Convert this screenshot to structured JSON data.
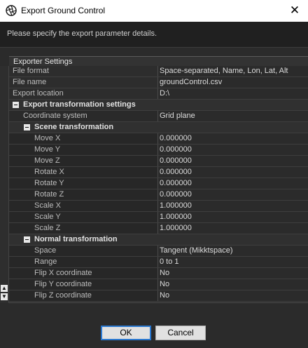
{
  "window": {
    "title": "Export Ground Control",
    "app_icon": "camera-aperture-icon",
    "close_glyph": "✕"
  },
  "instruction": "Please specify the export parameter details.",
  "group": {
    "title": "Exporter Settings"
  },
  "rows": [
    {
      "type": "prop",
      "depth": 0,
      "label": "File format",
      "value": "Space-separated, Name, Lon, Lat, Alt"
    },
    {
      "type": "prop",
      "depth": 0,
      "label": "File name",
      "value": "groundControl.csv"
    },
    {
      "type": "prop",
      "depth": 0,
      "label": "Export location",
      "value": "D:\\"
    },
    {
      "type": "cat",
      "depth": 1,
      "label": "Export transformation settings",
      "expanded": true
    },
    {
      "type": "prop",
      "depth": 1,
      "label": "Coordinate system",
      "value": "Grid plane"
    },
    {
      "type": "cat",
      "depth": 2,
      "label": "Scene transformation",
      "expanded": true
    },
    {
      "type": "prop",
      "depth": 2,
      "label": "Move X",
      "value": "0.000000"
    },
    {
      "type": "prop",
      "depth": 2,
      "label": "Move Y",
      "value": "0.000000"
    },
    {
      "type": "prop",
      "depth": 2,
      "label": "Move Z",
      "value": "0.000000"
    },
    {
      "type": "prop",
      "depth": 2,
      "label": "Rotate X",
      "value": "0.000000"
    },
    {
      "type": "prop",
      "depth": 2,
      "label": "Rotate Y",
      "value": "0.000000"
    },
    {
      "type": "prop",
      "depth": 2,
      "label": "Rotate Z",
      "value": "0.000000"
    },
    {
      "type": "prop",
      "depth": 2,
      "label": "Scale X",
      "value": "1.000000"
    },
    {
      "type": "prop",
      "depth": 2,
      "label": "Scale Y",
      "value": "1.000000"
    },
    {
      "type": "prop",
      "depth": 2,
      "label": "Scale Z",
      "value": "1.000000"
    },
    {
      "type": "cat",
      "depth": 2,
      "label": "Normal transformation",
      "expanded": true
    },
    {
      "type": "prop",
      "depth": 2,
      "label": "Space",
      "value": "Tangent (Mikktspace)"
    },
    {
      "type": "prop",
      "depth": 2,
      "label": "Range",
      "value": "0 to 1"
    },
    {
      "type": "prop",
      "depth": 2,
      "label": "Flip X coordinate",
      "value": "No"
    },
    {
      "type": "prop",
      "depth": 2,
      "label": "Flip Y coordinate",
      "value": "No"
    },
    {
      "type": "prop",
      "depth": 2,
      "label": "Flip Z coordinate",
      "value": "No"
    }
  ],
  "scroll": {
    "up_icon": "scroll-up-icon",
    "down_icon": "scroll-down-icon"
  },
  "buttons": {
    "ok": "OK",
    "cancel": "Cancel"
  },
  "colors": {
    "background": "#2b2b2b",
    "focus_accent": "#2a78d0",
    "titlebar": "#ffffff"
  }
}
